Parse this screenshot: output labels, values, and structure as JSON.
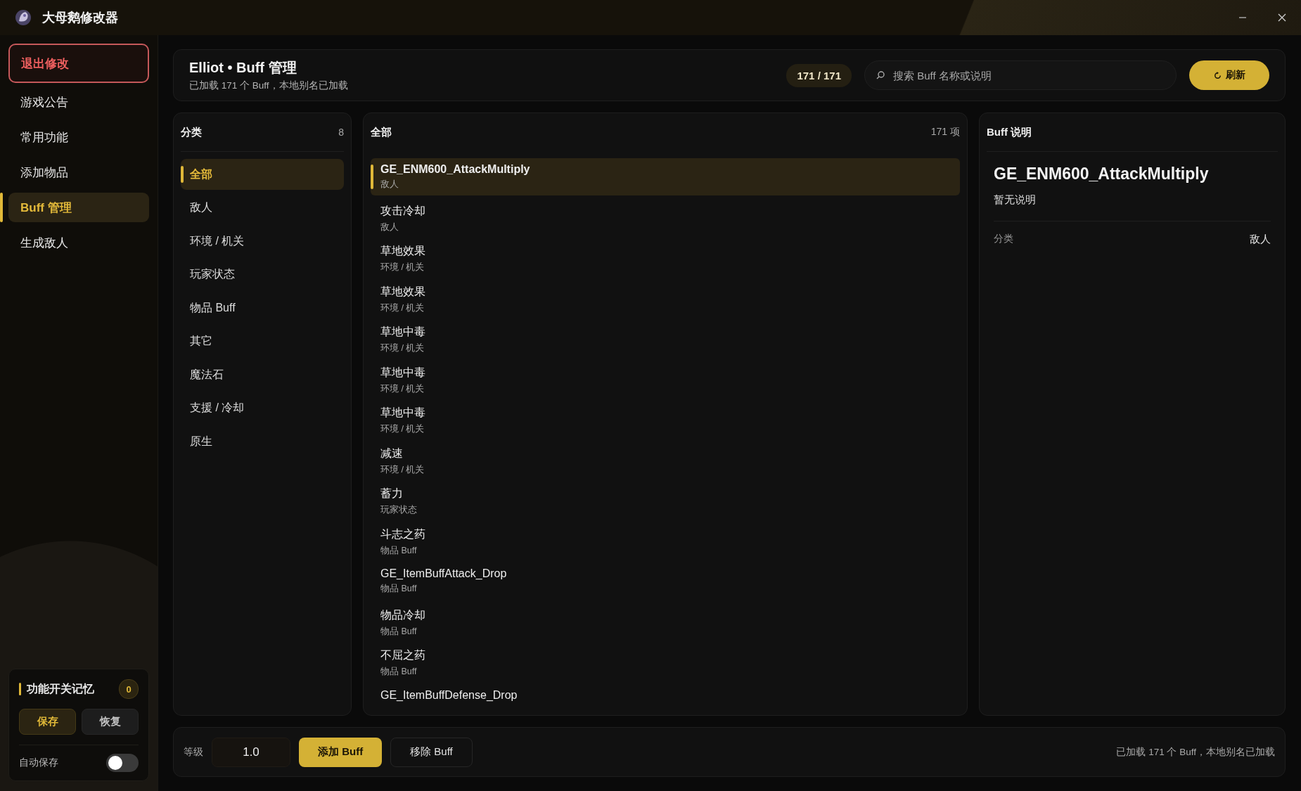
{
  "app": {
    "title": "大母鹅修改器"
  },
  "sidebar": {
    "items": [
      {
        "label": "退出修改",
        "kind": "exit",
        "selected": false
      },
      {
        "label": "游戏公告",
        "kind": "nav",
        "selected": false
      },
      {
        "label": "常用功能",
        "kind": "nav",
        "selected": false
      },
      {
        "label": "添加物品",
        "kind": "nav",
        "selected": false
      },
      {
        "label": "Buff 管理",
        "kind": "nav",
        "selected": true
      },
      {
        "label": "生成敌人",
        "kind": "nav",
        "selected": false
      }
    ]
  },
  "memory": {
    "title": "功能开关记忆",
    "count": "0",
    "buttons": [
      {
        "label": "保存",
        "kind": "primary"
      },
      {
        "label": "恢复",
        "kind": "secondary"
      }
    ],
    "auto_save": {
      "label": "自动保存",
      "on": false
    }
  },
  "header": {
    "title": "Elliot • Buff 管理",
    "subtitle": "已加载 171 个 Buff，本地别名已加载",
    "count": "171 / 171",
    "search": {
      "placeholder": "搜索 Buff 名称或说明"
    },
    "refresh": "刷新"
  },
  "categories": {
    "title": "分类",
    "count": "8",
    "items": [
      {
        "label": "全部",
        "selected": true
      },
      {
        "label": "敌人",
        "selected": false
      },
      {
        "label": "环境 / 机关",
        "selected": false
      },
      {
        "label": "玩家状态",
        "selected": false
      },
      {
        "label": "物品 Buff",
        "selected": false
      },
      {
        "label": "其它",
        "selected": false
      },
      {
        "label": "魔法石",
        "selected": false
      },
      {
        "label": "支援 / 冷却",
        "selected": false
      },
      {
        "label": "原生",
        "selected": false
      }
    ]
  },
  "list": {
    "title": "全部",
    "count": "171 项",
    "items": [
      {
        "name": "GE_ENM600_AttackMultiply",
        "category": "敌人",
        "selected": true
      },
      {
        "name": "攻击冷却",
        "category": "敌人",
        "selected": false
      },
      {
        "name": "草地效果",
        "category": "环境 / 机关",
        "selected": false
      },
      {
        "name": "草地效果",
        "category": "环境 / 机关",
        "selected": false
      },
      {
        "name": "草地中毒",
        "category": "环境 / 机关",
        "selected": false
      },
      {
        "name": "草地中毒",
        "category": "环境 / 机关",
        "selected": false
      },
      {
        "name": "草地中毒",
        "category": "环境 / 机关",
        "selected": false
      },
      {
        "name": "减速",
        "category": "环境 / 机关",
        "selected": false
      },
      {
        "name": "蓄力",
        "category": "玩家状态",
        "selected": false
      },
      {
        "name": "斗志之药",
        "category": "物品 Buff",
        "selected": false
      },
      {
        "name": "GE_ItemBuffAttack_Drop",
        "category": "物品 Buff",
        "selected": false
      },
      {
        "name": "物品冷却",
        "category": "物品 Buff",
        "selected": false
      },
      {
        "name": "不屈之药",
        "category": "物品 Buff",
        "selected": false
      },
      {
        "name": "GE_ItemBuffDefense_Drop",
        "selected": false
      }
    ]
  },
  "detail": {
    "title": "Buff 说明",
    "name": "GE_ENM600_AttackMultiply",
    "description": "暂无说明",
    "fields": [
      {
        "label": "分类",
        "value": "敌人"
      }
    ]
  },
  "footer": {
    "level_label": "等级",
    "level_value": "1.0",
    "add": "添加 Buff",
    "remove": "移除 Buff",
    "status": "已加载 171 个 Buff，本地别名已加载"
  }
}
